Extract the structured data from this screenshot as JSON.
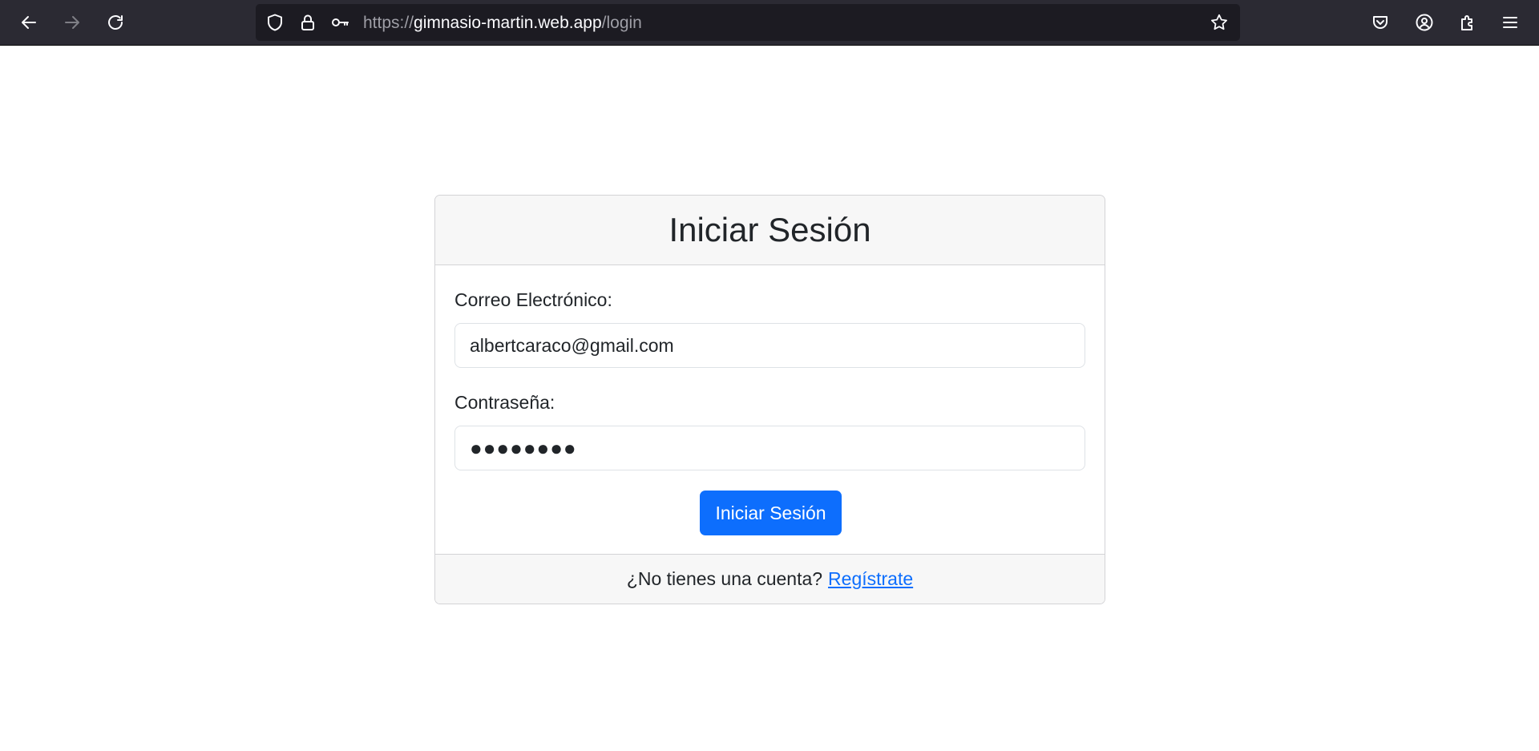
{
  "browser": {
    "url_prefix": "https://",
    "url_host": "gimnasio-martin.web.app",
    "url_path": "/login",
    "icons": {
      "back": "arrow-left-icon",
      "forward": "arrow-right-icon",
      "reload": "reload-icon",
      "shield": "shield-icon",
      "lock": "lock-icon",
      "key": "key-icon",
      "bookmark": "star-icon",
      "pocket": "pocket-icon",
      "account": "account-icon",
      "extensions": "puzzle-icon",
      "menu": "hamburger-menu-icon"
    }
  },
  "login": {
    "title": "Iniciar Sesión",
    "email_label": "Correo Electrónico:",
    "email_value": "albertcaraco@gmail.com",
    "password_label": "Contraseña:",
    "password_mask": "●●●●●●●●",
    "submit_label": "Iniciar Sesión",
    "footer_text": "¿No tienes una cuenta?",
    "register_link": "Regístrate"
  },
  "colors": {
    "primary": "#0d6efd",
    "toolbar": "#2b2a33",
    "urlbar": "#1c1b22"
  }
}
